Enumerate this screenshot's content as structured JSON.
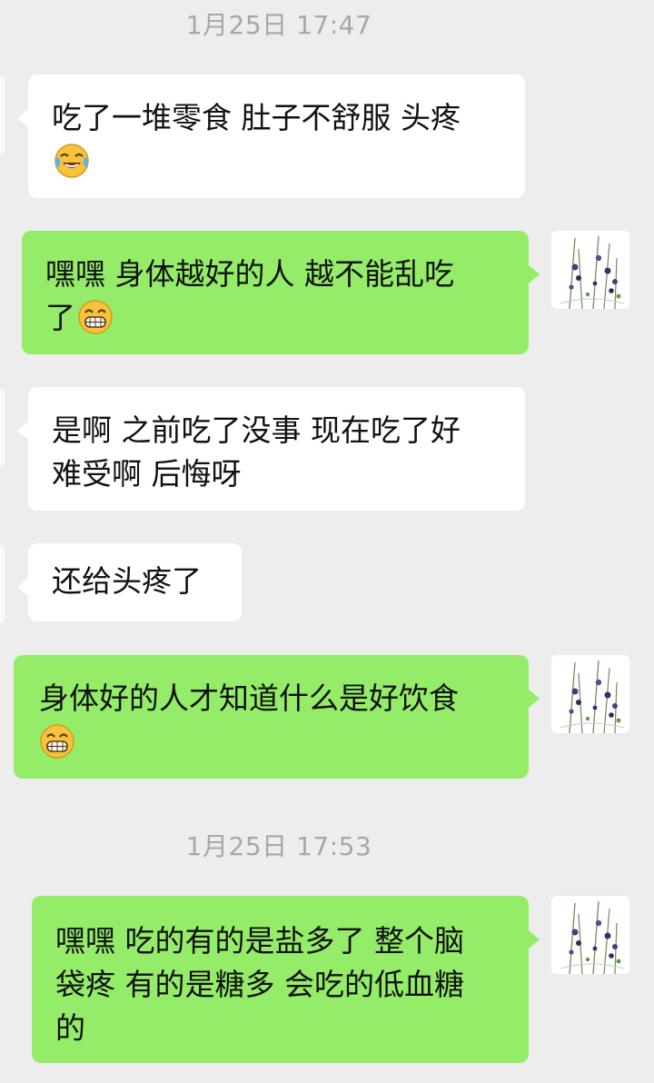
{
  "timestamps": [
    "1月25日 17:47",
    "1月25日 17:53"
  ],
  "messages": [
    {
      "side": "left",
      "lines": [
        "吃了一堆零食 肚子不舒服 头疼"
      ],
      "emoji": "tears-of-joy"
    },
    {
      "side": "right",
      "lines": [
        " 嘿嘿 身体越好的人 越不能乱吃",
        "了"
      ],
      "emoji": "grin"
    },
    {
      "side": "left",
      "lines": [
        "是啊 之前吃了没事 现在吃了好",
        "难受啊 后悔呀"
      ],
      "emoji": null
    },
    {
      "side": "left",
      "lines": [
        "还给头疼了"
      ],
      "emoji": null
    },
    {
      "side": "right",
      "lines": [
        "身体好的人才知道什么是好饮食"
      ],
      "emoji": "grin"
    },
    {
      "side": "right",
      "lines": [
        "嘿嘿 吃的有的是盐多了 整个脑",
        "袋疼 有的是糖多 会吃的低血糖",
        "的"
      ],
      "emoji": null
    }
  ],
  "colors": {
    "background": "#ededed",
    "left_bubble": "#ffffff",
    "right_bubble": "#95ec69",
    "timestamp_text": "#a7a7a7"
  }
}
